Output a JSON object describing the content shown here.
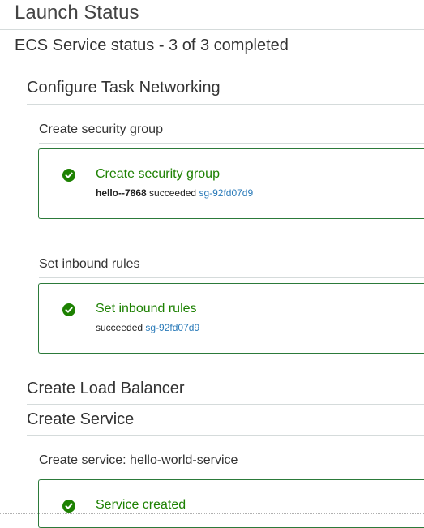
{
  "header": {
    "title": "Launch Status",
    "subtitle": "ECS Service status - 3 of 3 completed"
  },
  "sections": {
    "networking": {
      "title": "Configure Task Networking",
      "security_group": {
        "label": "Create security group",
        "item_title": "Create security group",
        "resource_name": "hello--7868",
        "status": "succeeded",
        "link": "sg-92fd07d9"
      },
      "inbound_rules": {
        "label": "Set inbound rules",
        "item_title": "Set inbound rules",
        "status": "succeeded",
        "link": "sg-92fd07d9"
      }
    },
    "load_balancer": {
      "title": "Create Load Balancer"
    },
    "service": {
      "title": "Create Service",
      "label": "Create service: hello-world-service",
      "item_title": "Service created"
    }
  },
  "colors": {
    "success": "#1d8102",
    "link": "#2b7bb9",
    "border_success": "#2c7a3a",
    "rule": "#d5dbdb"
  },
  "icons": [
    "check-circle-icon"
  ]
}
